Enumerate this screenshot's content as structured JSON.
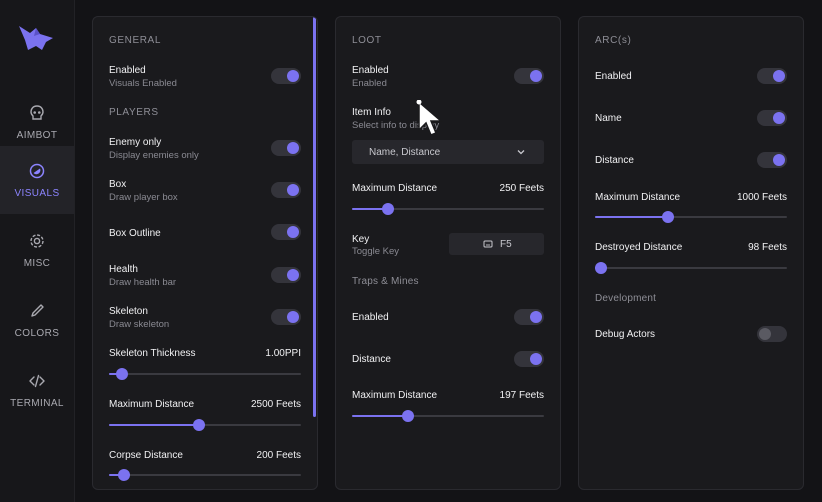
{
  "sidebar": {
    "items": [
      {
        "label": "AIMBOT",
        "icon": "skull-icon"
      },
      {
        "label": "VISUALS",
        "icon": "visuals-icon",
        "active": true
      },
      {
        "label": "MISC",
        "icon": "gear-icon"
      },
      {
        "label": "COLORS",
        "icon": "dropper-icon"
      },
      {
        "label": "TERMINAL",
        "icon": "code-icon"
      }
    ]
  },
  "colors": {
    "accent": "#7b72f0",
    "panel": "#1a1a1d",
    "background": "#131316"
  },
  "general": {
    "title": "GENERAL",
    "enabled": {
      "label": "Enabled",
      "sub": "Visuals Enabled",
      "on": true
    },
    "players_title": "PLAYERS",
    "enemy_only": {
      "label": "Enemy only",
      "sub": "Display enemies only",
      "on": true
    },
    "box": {
      "label": "Box",
      "sub": "Draw player box",
      "on": true
    },
    "box_outline": {
      "label": "Box Outline",
      "on": true
    },
    "health": {
      "label": "Health",
      "sub": "Draw health bar",
      "on": true
    },
    "skeleton": {
      "label": "Skeleton",
      "sub": "Draw skeleton",
      "on": true
    },
    "skeleton_thickness": {
      "label": "Skeleton Thickness",
      "value": "1.00PPI",
      "fraction": 0.07
    },
    "max_distance": {
      "label": "Maximum Distance",
      "value": "2500 Feets",
      "fraction": 0.47
    },
    "corpse_distance": {
      "label": "Corpse Distance",
      "value": "200 Feets",
      "fraction": 0.08
    }
  },
  "loot": {
    "title": "LOOT",
    "enabled": {
      "label": "Enabled",
      "sub": "Enabled",
      "on": true
    },
    "item_info": {
      "label": "Item Info",
      "sub": "Select info to display",
      "selected": "Name, Distance"
    },
    "max_distance": {
      "label": "Maximum Distance",
      "value": "250 Feets",
      "fraction": 0.19
    },
    "key": {
      "label": "Key",
      "sub": "Toggle Key",
      "value": "F5"
    },
    "traps_title": "Traps & Mines",
    "traps_enabled": {
      "label": "Enabled",
      "on": true
    },
    "traps_distance": {
      "label": "Distance",
      "on": true
    },
    "traps_max_distance": {
      "label": "Maximum Distance",
      "value": "197 Feets",
      "fraction": 0.29
    }
  },
  "arcs": {
    "title": "ARC(s)",
    "enabled": {
      "label": "Enabled",
      "on": true
    },
    "name": {
      "label": "Name",
      "on": true
    },
    "distance": {
      "label": "Distance",
      "on": true
    },
    "max_distance": {
      "label": "Maximum Distance",
      "value": "1000 Feets",
      "fraction": 0.38
    },
    "destroyed_distance": {
      "label": "Destroyed Distance",
      "value": "98 Feets",
      "fraction": 0.03
    },
    "development_title": "Development",
    "debug_actors": {
      "label": "Debug Actors",
      "on": false
    }
  }
}
